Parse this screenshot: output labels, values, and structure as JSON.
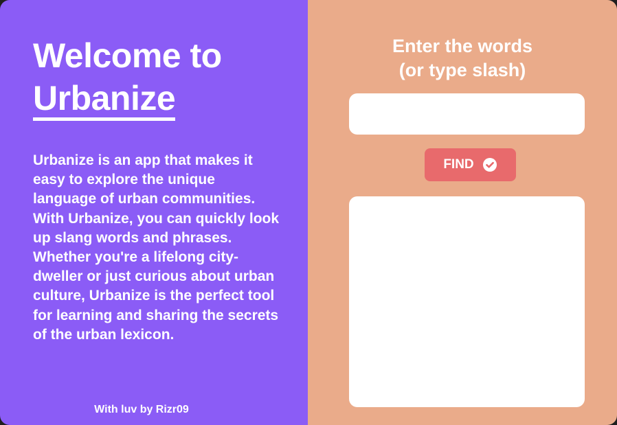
{
  "colors": {
    "left_panel_bg": "#8b5cf6",
    "right_panel_bg": "#eaab8a",
    "button_bg": "#e86a6c",
    "text": "#ffffff"
  },
  "left": {
    "title_prefix": "Welcome to",
    "title_brand": "Urbanize",
    "description": "Urbanize is an app that makes it easy to explore the unique language of urban communities. With Urbanize, you can quickly look up slang words and phrases. Whether you're a lifelong city-dweller or just curious about urban culture, Urbanize is the perfect tool for learning and sharing the secrets of the urban lexicon.",
    "footer": "With luv by Rizr09"
  },
  "right": {
    "prompt_line1": "Enter the words",
    "prompt_line2": "(or type slash)",
    "input_value": "",
    "find_label": "FIND",
    "find_icon": "check-circle-icon",
    "results_text": ""
  }
}
